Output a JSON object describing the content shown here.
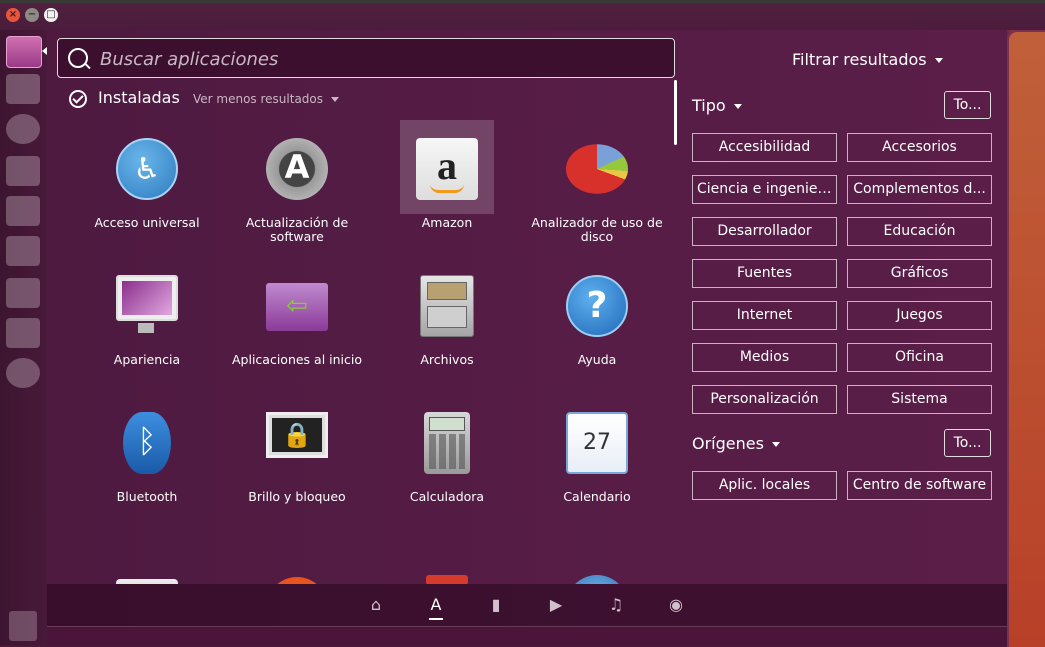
{
  "window": {
    "close": "×",
    "minimize": "−",
    "maximize": "□"
  },
  "search": {
    "placeholder": "Buscar aplicaciones",
    "value": ""
  },
  "section": {
    "title": "Instaladas",
    "more": "Ver menos resultados"
  },
  "apps": [
    {
      "label": "Acceso universal",
      "icon": "accessibility-icon",
      "glyph": "♿"
    },
    {
      "label": "Actualización de software",
      "icon": "software-update-icon",
      "glyph": "A"
    },
    {
      "label": "Amazon",
      "icon": "amazon-icon",
      "glyph": "a",
      "selected": true
    },
    {
      "label": "Analizador de uso de disco",
      "icon": "disk-usage-icon",
      "glyph": ""
    },
    {
      "label": "Apariencia",
      "icon": "appearance-icon",
      "glyph": ""
    },
    {
      "label": "Aplicaciones al inicio",
      "icon": "startup-apps-icon",
      "glyph": "⇦"
    },
    {
      "label": "Archivos",
      "icon": "files-icon",
      "glyph": ""
    },
    {
      "label": "Ayuda",
      "icon": "help-icon",
      "glyph": "?"
    },
    {
      "label": "Bluetooth",
      "icon": "bluetooth-icon",
      "glyph": "ᛒ"
    },
    {
      "label": "Brillo y bloqueo",
      "icon": "brightness-lock-icon",
      "glyph": "🔒"
    },
    {
      "label": "Calculadora",
      "icon": "calculator-icon",
      "glyph": ""
    },
    {
      "label": "Calendario",
      "icon": "calendar-icon",
      "glyph": "27"
    }
  ],
  "dock": {
    "items": [
      "home-lens-icon",
      "applications-lens-icon",
      "files-lens-icon",
      "video-lens-icon",
      "music-lens-icon",
      "photos-lens-icon"
    ],
    "active": "applications-lens-icon"
  },
  "filters": {
    "title": "Filtrar resultados",
    "type": {
      "title": "Tipo",
      "all_label": "To...",
      "options": [
        "Accesibilidad",
        "Accesorios",
        "Ciencia e ingeniería",
        "Complementos d...",
        "Desarrollador",
        "Educación",
        "Fuentes",
        "Gráficos",
        "Internet",
        "Juegos",
        "Medios",
        "Oficina",
        "Personalización",
        "Sistema"
      ]
    },
    "sources": {
      "title": "Orígenes",
      "all_label": "To...",
      "options": [
        "Aplic. locales",
        "Centro de software"
      ]
    }
  },
  "colors": {
    "accent": "#5a1e48",
    "launcher": "#3d1530",
    "selected_tile": "#7a4a6a"
  }
}
